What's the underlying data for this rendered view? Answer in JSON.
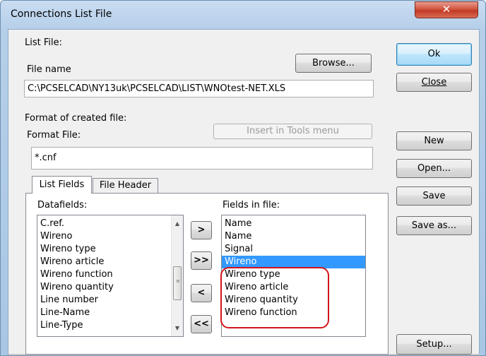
{
  "window": {
    "title": "Connections List File",
    "close_symbol": "✕"
  },
  "list_file": {
    "section_label": "List File:",
    "browse_label": "Browse...",
    "file_name_label": "File name",
    "file_name_value": "C:\\PCSELCAD\\NY13uk\\PCSELCAD\\LIST\\WNOtest-NET.XLS"
  },
  "format": {
    "section_label": "Format of created file:",
    "format_file_label": "Format File:",
    "insert_tools_label": "Insert in Tools menu",
    "format_file_value": "*.cnf"
  },
  "tabs": [
    {
      "label": "List Fields"
    },
    {
      "label": "File Header"
    }
  ],
  "datafields": {
    "label": "Datafields:",
    "items": [
      "C.ref.",
      "Wireno",
      "Wireno type",
      "Wireno article",
      "Wireno function",
      "Wireno quantity",
      "Line number",
      "Line-Name",
      "Line-Type"
    ]
  },
  "move_buttons": {
    "add": ">",
    "add_all": ">>",
    "remove": "<",
    "remove_all": "<<"
  },
  "fields_in_file": {
    "label": "Fields in file:",
    "items": [
      "Name",
      "Name",
      "Signal",
      "Wireno",
      "Wireno type",
      "Wireno article",
      "Wireno quantity",
      "Wireno function"
    ],
    "selected_index": 3
  },
  "side_buttons": {
    "ok": "Ok",
    "close": "Close",
    "new": "New",
    "open": "Open...",
    "save": "Save",
    "save_as": "Save as...",
    "setup": "Setup..."
  },
  "colors": {
    "selection": "#3399ff",
    "annotation": "#d1141b"
  }
}
